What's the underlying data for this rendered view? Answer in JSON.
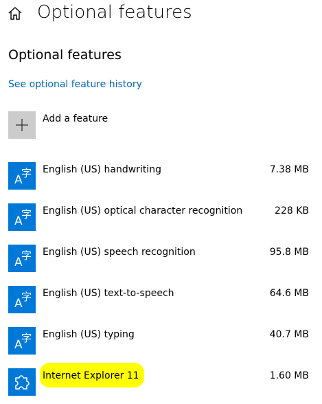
{
  "header": {
    "home_icon": "home-icon",
    "title": "Optional features"
  },
  "section": {
    "title": "Optional features",
    "history_link": "See optional feature history"
  },
  "add_feature": {
    "icon": "plus-icon",
    "label": "Add a feature"
  },
  "features": [
    {
      "name": "English (US) handwriting",
      "size": "7.38 MB",
      "icon": "language-icon"
    },
    {
      "name": "English (US) optical character recognition",
      "size": "228 KB",
      "icon": "language-icon"
    },
    {
      "name": "English (US) speech recognition",
      "size": "95.8 MB",
      "icon": "language-icon"
    },
    {
      "name": "English (US) text-to-speech",
      "size": "64.6 MB",
      "icon": "language-icon"
    },
    {
      "name": "English (US) typing",
      "size": "40.7 MB",
      "icon": "language-icon"
    },
    {
      "name": "Internet Explorer 11",
      "size": "1.60 MB",
      "icon": "puzzle-piece-icon",
      "highlighted": true
    }
  ],
  "colors": {
    "accent": "#0078d7",
    "link": "#0067b8",
    "add_tile": "#cccccc",
    "highlight": "#ffff00"
  }
}
